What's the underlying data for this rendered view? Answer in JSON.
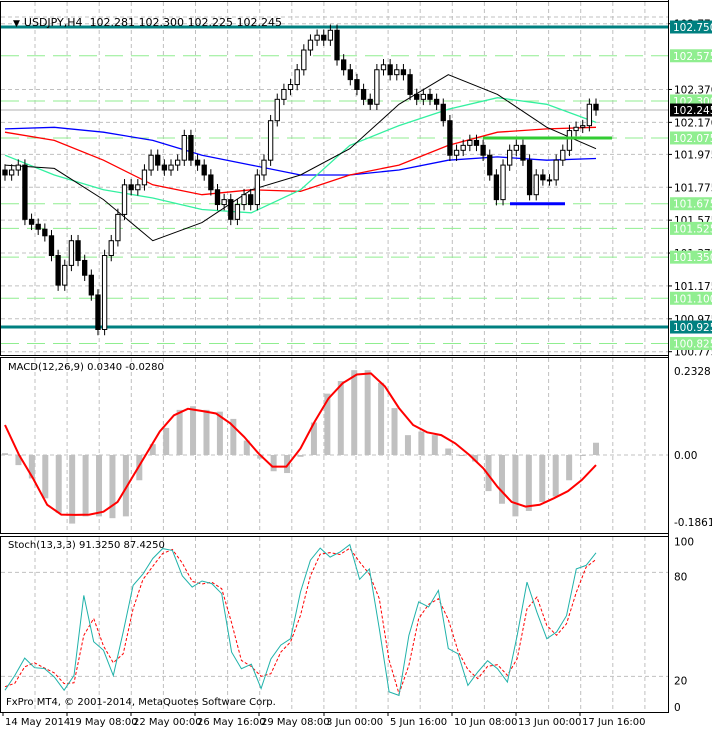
{
  "header": {
    "symbol": "USDJPY,H4",
    "open": "102.281",
    "high": "102.300",
    "low": "102.225",
    "close": "102.245"
  },
  "copyright": "FxPro MT4, © 2001-2014, MetaQuotes Software Corp.",
  "colors": {
    "teal_level": "#008080",
    "green_level": "#90ee90",
    "ma_blue": "#0000ff",
    "ma_red": "#ff0000",
    "ma_mint": "#33f0a0",
    "ma_black": "#000000",
    "support_green": "#33cc33",
    "support_blue": "#0000ff",
    "macd_hist": "#c0c0c0",
    "macd_signal": "#ff0000",
    "stoch_main": "#20b2aa",
    "stoch_signal": "#ff0000"
  },
  "chart_data": [
    {
      "type": "candlestick",
      "title": "USDJPY,H4",
      "ylim": [
        100.775,
        102.81
      ],
      "grid": true,
      "closes": [
        101.85,
        101.88,
        101.91,
        101.58,
        101.55,
        101.52,
        101.48,
        101.36,
        101.18,
        101.3,
        101.45,
        101.33,
        101.24,
        101.12,
        100.91,
        101.36,
        101.45,
        101.61,
        101.79,
        101.76,
        101.79,
        101.88,
        101.97,
        101.91,
        101.88,
        101.91,
        101.94,
        102.09,
        101.94,
        101.91,
        101.85,
        101.76,
        101.67,
        101.7,
        101.58,
        101.67,
        101.73,
        101.67,
        101.85,
        101.94,
        102.18,
        102.31,
        102.37,
        102.4,
        102.49,
        102.61,
        102.67,
        102.7,
        102.67,
        102.73,
        102.55,
        102.49,
        102.43,
        102.37,
        102.31,
        102.28,
        102.49,
        102.52,
        102.46,
        102.49,
        102.46,
        102.34,
        102.31,
        102.34,
        102.31,
        102.28,
        102.18,
        101.97,
        102.0,
        102.03,
        102.06,
        102.03,
        101.97,
        101.85,
        101.7,
        101.91,
        102.0,
        102.03,
        101.94,
        101.73,
        101.85,
        101.82,
        101.82,
        101.94,
        102.0,
        102.12,
        102.14,
        102.15,
        102.28,
        102.245
      ],
      "moving_averages": [
        {
          "color": "#0000ff",
          "values": [
            102.13,
            102.14,
            102.11,
            102.06,
            101.97,
            101.91,
            101.85,
            101.85,
            101.88,
            101.94,
            101.96,
            101.94,
            101.95
          ]
        },
        {
          "color": "#ff0000",
          "values": [
            102.11,
            102.06,
            101.94,
            101.79,
            101.73,
            101.76,
            101.75,
            101.85,
            101.91,
            102.03,
            102.11,
            102.13,
            102.14
          ]
        },
        {
          "color": "#33f0a0",
          "values": [
            101.97,
            101.85,
            101.76,
            101.71,
            101.64,
            101.62,
            101.76,
            102.03,
            102.15,
            102.25,
            102.32,
            102.28,
            102.17
          ]
        },
        {
          "color": "#000000",
          "values": [
            101.91,
            101.89,
            101.7,
            101.45,
            101.56,
            101.76,
            101.85,
            102.01,
            102.28,
            102.46,
            102.34,
            102.14,
            102.01
          ]
        }
      ],
      "level_labels_teal": [
        "102.750",
        "100.925"
      ],
      "level_labels_green": [
        "102.575",
        "102.300",
        "102.075",
        "101.675",
        "101.525",
        "101.350",
        "101.100",
        "100.825"
      ],
      "tick_labels": [
        "102.770",
        "102.370",
        "102.170",
        "101.975",
        "101.775",
        "101.575",
        "101.375",
        "101.175",
        "100.975",
        "100.775"
      ],
      "current_price": "102.245",
      "support_green": 102.075,
      "support_blue": 101.675
    },
    {
      "type": "bar",
      "title": "MACD(12,26,9) 0.0340 -0.0280",
      "ylim": [
        -0.1861,
        0.2328
      ],
      "tick_labels": [
        "0.2328",
        "0.00",
        "-0.1861"
      ],
      "histogram": [
        0.005,
        -0.028,
        -0.065,
        -0.12,
        -0.16,
        -0.19,
        -0.17,
        -0.17,
        -0.175,
        -0.17,
        -0.07,
        0.03,
        0.075,
        0.125,
        0.135,
        0.125,
        0.12,
        0.1,
        0.04,
        -0.01,
        -0.045,
        -0.05,
        -0.005,
        0.09,
        0.17,
        0.205,
        0.235,
        0.235,
        0.2,
        0.13,
        0.055,
        0.065,
        0.055,
        0.018,
        0.0,
        -0.018,
        -0.1,
        -0.135,
        -0.17,
        -0.155,
        -0.13,
        -0.115,
        -0.07,
        0.0,
        0.034
      ],
      "signal": [
        0.083,
        0.0,
        -0.065,
        -0.138,
        -0.165,
        -0.166,
        -0.165,
        -0.157,
        -0.13,
        -0.065,
        0.0,
        0.065,
        0.11,
        0.128,
        0.122,
        0.115,
        0.088,
        0.05,
        0.005,
        -0.032,
        -0.032,
        0.018,
        0.092,
        0.157,
        0.199,
        0.223,
        0.226,
        0.19,
        0.13,
        0.083,
        0.063,
        0.055,
        0.032,
        0.0,
        -0.037,
        -0.088,
        -0.13,
        -0.143,
        -0.138,
        -0.12,
        -0.1,
        -0.069,
        -0.028
      ]
    },
    {
      "type": "line",
      "title": "Stoch(13,3,3) 91.3250 87.4250",
      "ylim": [
        0,
        100
      ],
      "tick_labels": [
        "100",
        "80",
        "20",
        "0"
      ],
      "main": [
        12,
        20.5,
        30.5,
        25,
        24.5,
        19.6,
        12,
        20.5,
        66.7,
        40,
        35,
        20.5,
        45.6,
        72.5,
        79,
        88,
        93.7,
        92.7,
        78,
        71.5,
        75,
        73.5,
        67.7,
        34,
        24.4,
        27,
        13,
        30,
        38,
        41.7,
        68.7,
        87,
        94,
        88.8,
        91.7,
        96,
        76,
        82,
        47.5,
        11,
        9,
        43.7,
        63,
        60,
        69.6,
        36,
        33,
        14.8,
        22.5,
        29,
        24.4,
        16.7,
        43.6,
        74.4,
        57,
        41.7,
        45.6,
        55,
        82,
        84,
        91.3
      ],
      "signal": [
        14,
        16,
        25.5,
        27.8,
        24.8,
        22,
        15.8,
        16.3,
        43.6,
        53.4,
        37.5,
        27.8,
        33,
        59,
        75.8,
        83.5,
        90.9,
        93.2,
        85.4,
        74.8,
        73.3,
        74.3,
        70.6,
        50.9,
        29.2,
        25.7,
        20,
        21.5,
        34,
        39.9,
        55.2,
        77.9,
        90.5,
        91.4,
        90.3,
        93.9,
        86,
        79,
        64.8,
        29.3,
        10,
        26.4,
        53.4,
        61.5,
        64.8,
        52.8,
        34.5,
        23.9,
        18.7,
        25.8,
        26.7,
        20.6,
        30.2,
        59,
        65.7,
        49.4,
        43.7,
        50.3,
        68.5,
        83,
        87.4
      ]
    }
  ],
  "x_axis": {
    "tick_labels": [
      "14 May 2014",
      "19 May 08:00",
      "22 May 00:00",
      "26 May 16:00",
      "29 May 08:00",
      "3 Jun 00:00",
      "5 Jun 16:00",
      "10 Jun 08:00",
      "13 Jun 00:00",
      "17 Jun 16:00"
    ]
  }
}
